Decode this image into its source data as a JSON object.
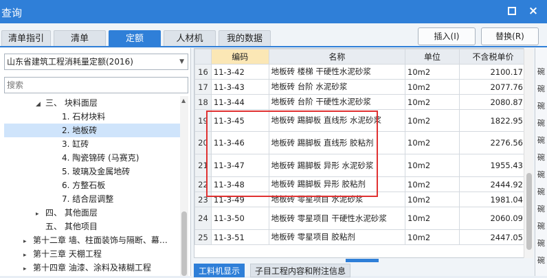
{
  "window": {
    "title": "查询",
    "maximize_label": "",
    "close_label": "×"
  },
  "tabs": [
    {
      "label": "清单指引"
    },
    {
      "label": "清单"
    },
    {
      "label": "定额"
    },
    {
      "label": "人材机"
    },
    {
      "label": "我的数据"
    }
  ],
  "actions": {
    "insert": "插入(I)",
    "replace": "替换(R)"
  },
  "left": {
    "quota_select": "山东省建筑工程消耗量定额(2016)",
    "search_placeholder": "搜索",
    "tree": [
      {
        "label": "三、 块料面层",
        "caret": "◢"
      },
      {
        "label": "1. 石材块料",
        "caret": ""
      },
      {
        "label": "2. 地板砖",
        "caret": ""
      },
      {
        "label": "3. 缸砖",
        "caret": ""
      },
      {
        "label": "4. 陶瓷锦砖 (马赛克)",
        "caret": ""
      },
      {
        "label": "5. 玻璃及金属地砖",
        "caret": ""
      },
      {
        "label": "6. 方整石板",
        "caret": ""
      },
      {
        "label": "7. 结合层调整",
        "caret": ""
      },
      {
        "label": "四、 其他面层",
        "caret": "▸"
      },
      {
        "label": "五、 其他项目",
        "caret": ""
      },
      {
        "label": "第十二章 墙、柱面装饰与隔断、幕…",
        "caret": "▸"
      },
      {
        "label": "第十三章 天棚工程",
        "caret": "▸"
      },
      {
        "label": "第十四章 油漆、涂料及裱糊工程",
        "caret": "▸"
      }
    ]
  },
  "grid": {
    "headers": {
      "code": "编码",
      "name": "名称",
      "unit": "单位",
      "price": "不含税单价"
    },
    "rows": [
      {
        "no": "16",
        "code": "11-3-42",
        "name": "地板砖 楼梯 干硬性水泥砂浆",
        "unit": "10m2",
        "price": "2100.17"
      },
      {
        "no": "17",
        "code": "11-3-43",
        "name": "地板砖 台阶 水泥砂浆",
        "unit": "10m2",
        "price": "2077.76"
      },
      {
        "no": "18",
        "code": "11-3-44",
        "name": "地板砖 台阶 干硬性水泥砂浆",
        "unit": "10m2",
        "price": "2080.87"
      },
      {
        "no": "19",
        "code": "11-3-45",
        "name": "地板砖 踢脚板 直线形 水泥砂浆",
        "unit": "10m2",
        "price": "1822.95"
      },
      {
        "no": "20",
        "code": "11-3-46",
        "name": "地板砖 踢脚板 直线形 胶粘剂",
        "unit": "10m2",
        "price": "2276.56"
      },
      {
        "no": "21",
        "code": "11-3-47",
        "name": "地板砖 踢脚板 异形 水泥砂浆",
        "unit": "10m2",
        "price": "1955.43"
      },
      {
        "no": "22",
        "code": "11-3-48",
        "name": "地板砖 踢脚板 异形 胶粘剂",
        "unit": "10m2",
        "price": "2444.92"
      },
      {
        "no": "23",
        "code": "11-3-49",
        "name": "地板砖 零星项目 水泥砂浆",
        "unit": "10m2",
        "price": "1981.04"
      },
      {
        "no": "24",
        "code": "11-3-50",
        "name": "地板砖 零星项目 干硬性水泥砂浆",
        "unit": "10m2",
        "price": "2060.09"
      },
      {
        "no": "25",
        "code": "11-3-51",
        "name": "地板砖 零星项目 胶粘剂",
        "unit": "10m2",
        "price": "2447.05"
      }
    ]
  },
  "bottom_tabs": [
    {
      "label": "工料机显示"
    },
    {
      "label": "子目工程内容和附注信息"
    }
  ],
  "right_edge_chars": [
    "碗",
    "碗",
    "碗",
    "碗",
    "碗",
    "碗",
    "碗",
    "碗",
    "碗",
    "碗",
    "碗",
    "碗"
  ],
  "colors": {
    "accent": "#2f7fd8",
    "highlight_border": "#e03030",
    "selected_row": "#cfe4fb",
    "header_highlight": "#fbe7b5"
  }
}
